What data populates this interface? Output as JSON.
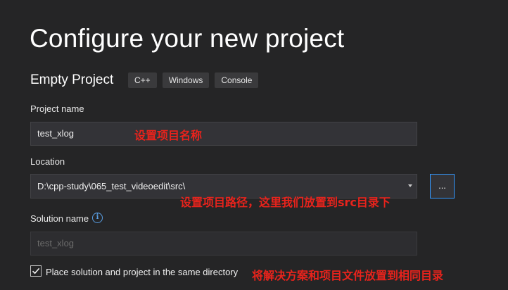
{
  "page": {
    "title": "Configure your new project",
    "template_name": "Empty Project",
    "tags": [
      "C++",
      "Windows",
      "Console"
    ]
  },
  "form": {
    "project_name_label": "Project name",
    "project_name_value": "test_xlog",
    "location_label": "Location",
    "location_value": "D:\\cpp-study\\065_test_videoedit\\src\\",
    "browse_label": "...",
    "solution_name_label": "Solution name",
    "solution_name_placeholder": "test_xlog",
    "same_directory_checked": true,
    "same_directory_label": "Place solution and project in the same directory"
  },
  "annotations": {
    "project_name_note": "设置项目名称",
    "location_note": "设置项目路径，这里我们放置到src目录下",
    "same_directory_note": "将解决方案和项目文件放置到相同目录"
  },
  "colors": {
    "background": "#252526",
    "accent": "#3399ff",
    "annotation": "#e8231c"
  },
  "icons": {
    "info": "info-icon",
    "checkmark": "checkmark-icon",
    "dropdown": "chevron-down-icon"
  }
}
